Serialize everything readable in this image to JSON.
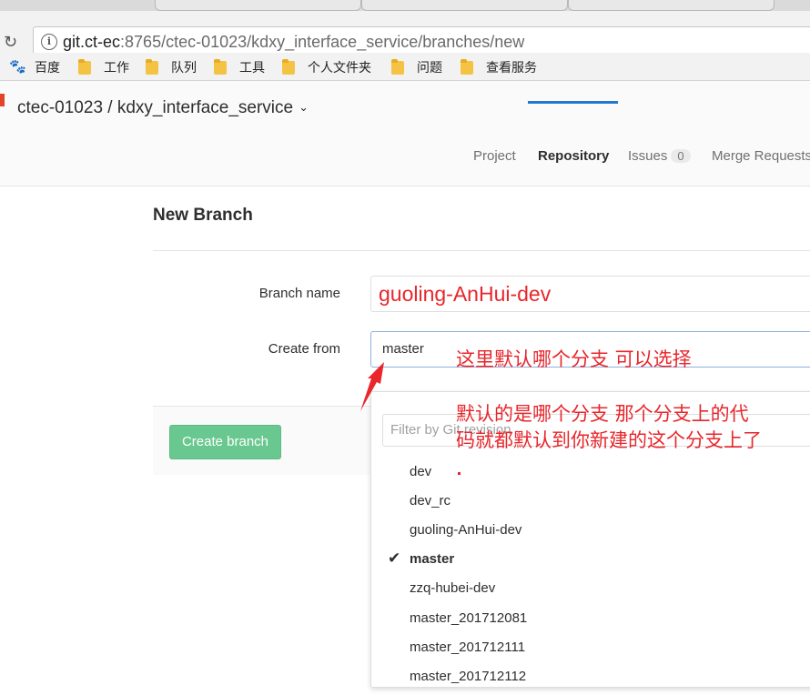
{
  "browser": {
    "url_host": "git.ct-ec",
    "url_rest": ":8765/ctec-01023/kdxy_interface_service/branches/new",
    "bookmarks": [
      "百度",
      "工作",
      "队列",
      "工具",
      "个人文件夹",
      "问题",
      "查看服务"
    ]
  },
  "header": {
    "breadcrumb": "ctec-01023 / kdxy_interface_service",
    "nav": [
      {
        "label": "Project"
      },
      {
        "label": "Repository"
      },
      {
        "label": "Issues",
        "badge": "0"
      },
      {
        "label": "Merge Requests"
      }
    ]
  },
  "page": {
    "title": "New Branch",
    "branch_name_label": "Branch name",
    "branch_name_value": "guoling-AnHui-dev",
    "create_from_label": "Create from",
    "create_from_value": "master",
    "create_button": "Create branch"
  },
  "dropdown": {
    "filter_placeholder": "Filter by Git revision",
    "branches": [
      {
        "label": "dev"
      },
      {
        "label": "dev_rc"
      },
      {
        "label": "guoling-AnHui-dev"
      },
      {
        "label": "master",
        "selected": true
      },
      {
        "label": "zzq-hubei-dev"
      },
      {
        "label": "master_201712081"
      },
      {
        "label": "master_201712111"
      },
      {
        "label": "master_201712112"
      }
    ]
  },
  "annotations": {
    "line1": "这里默认哪个分支 可以选择",
    "line2": "默认的是哪个分支 那个分支上的代",
    "line3": "码就都默认到你新建的这个分支上了"
  },
  "colors": {
    "accent": "#1f78d1",
    "create_button": "#69c88f",
    "annotation": "#e8262b"
  }
}
